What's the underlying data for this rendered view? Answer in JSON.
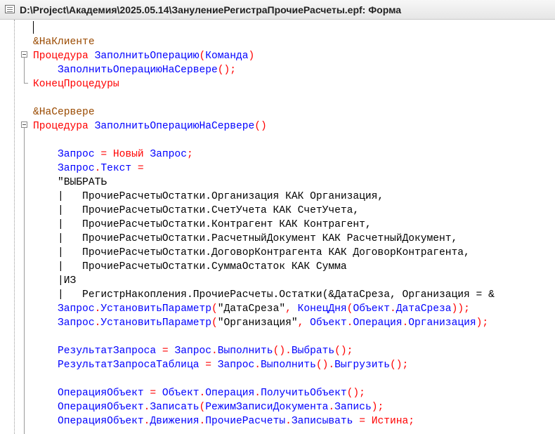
{
  "window": {
    "title": "D:\\Project\\Академия\\2025.05.14\\ЗанулениеРегистраПрочиеРасчеты.epf: Форма"
  },
  "code": {
    "lines": [
      [
        {
          "t": "&НаКлиенте",
          "c": "dir"
        }
      ],
      [
        {
          "t": "Процедура ",
          "c": "kw"
        },
        {
          "t": "ЗаполнитьОперацию",
          "c": "bl"
        },
        {
          "t": "(",
          "c": "kw"
        },
        {
          "t": "Команда",
          "c": "bl"
        },
        {
          "t": ")",
          "c": "kw"
        }
      ],
      [
        {
          "t": "    ",
          "c": "bl"
        },
        {
          "t": "ЗаполнитьОперациюНаСервере",
          "c": "bl"
        },
        {
          "t": "();",
          "c": "kw"
        }
      ],
      [
        {
          "t": "КонецПроцедуры",
          "c": "kw"
        }
      ],
      [],
      [
        {
          "t": "&НаСервере",
          "c": "dir"
        }
      ],
      [
        {
          "t": "Процедура ",
          "c": "kw"
        },
        {
          "t": "ЗаполнитьОперациюНаСервере",
          "c": "bl"
        },
        {
          "t": "()",
          "c": "kw"
        }
      ],
      [],
      [
        {
          "t": "    Запрос ",
          "c": "bl"
        },
        {
          "t": "= Новый ",
          "c": "kw"
        },
        {
          "t": "Запрос",
          "c": "bl"
        },
        {
          "t": ";",
          "c": "kw"
        }
      ],
      [
        {
          "t": "    Запрос",
          "c": "bl"
        },
        {
          "t": ".",
          "c": "kw"
        },
        {
          "t": "Текст ",
          "c": "bl"
        },
        {
          "t": "=",
          "c": "kw"
        }
      ],
      [
        {
          "t": "    \"ВЫБРАТЬ",
          "c": "bk"
        }
      ],
      [
        {
          "t": "    |   ПрочиеРасчетыОстатки.Организация КАК Организация,",
          "c": "bk"
        }
      ],
      [
        {
          "t": "    |   ПрочиеРасчетыОстатки.СчетУчета КАК СчетУчета,",
          "c": "bk"
        }
      ],
      [
        {
          "t": "    |   ПрочиеРасчетыОстатки.Контрагент КАК Контрагент,",
          "c": "bk"
        }
      ],
      [
        {
          "t": "    |   ПрочиеРасчетыОстатки.РасчетныйДокумент КАК РасчетныйДокумент,",
          "c": "bk"
        }
      ],
      [
        {
          "t": "    |   ПрочиеРасчетыОстатки.ДоговорКонтрагента КАК ДоговорКонтрагента,",
          "c": "bk"
        }
      ],
      [
        {
          "t": "    |   ПрочиеРасчетыОстатки.СуммаОстаток КАК Сумма",
          "c": "bk"
        }
      ],
      [
        {
          "t": "    |ИЗ",
          "c": "bk"
        }
      ],
      [
        {
          "t": "    |   РегистрНакопления.ПрочиеРасчеты.Остатки(&ДатаСреза, Организация = &",
          "c": "bk"
        }
      ],
      [
        {
          "t": "    Запрос",
          "c": "bl"
        },
        {
          "t": ".",
          "c": "kw"
        },
        {
          "t": "УстановитьПараметр",
          "c": "bl"
        },
        {
          "t": "(",
          "c": "kw"
        },
        {
          "t": "\"ДатаСреза\"",
          "c": "bk"
        },
        {
          "t": ", ",
          "c": "kw"
        },
        {
          "t": "КонецДня",
          "c": "bl"
        },
        {
          "t": "(",
          "c": "kw"
        },
        {
          "t": "Объект",
          "c": "bl"
        },
        {
          "t": ".",
          "c": "kw"
        },
        {
          "t": "ДатаСреза",
          "c": "bl"
        },
        {
          "t": "));",
          "c": "kw"
        }
      ],
      [
        {
          "t": "    Запрос",
          "c": "bl"
        },
        {
          "t": ".",
          "c": "kw"
        },
        {
          "t": "УстановитьПараметр",
          "c": "bl"
        },
        {
          "t": "(",
          "c": "kw"
        },
        {
          "t": "\"Организация\"",
          "c": "bk"
        },
        {
          "t": ", ",
          "c": "kw"
        },
        {
          "t": "Объект",
          "c": "bl"
        },
        {
          "t": ".",
          "c": "kw"
        },
        {
          "t": "Операция",
          "c": "bl"
        },
        {
          "t": ".",
          "c": "kw"
        },
        {
          "t": "Организация",
          "c": "bl"
        },
        {
          "t": ");",
          "c": "kw"
        }
      ],
      [],
      [
        {
          "t": "    РезультатЗапроса ",
          "c": "bl"
        },
        {
          "t": "= ",
          "c": "kw"
        },
        {
          "t": "Запрос",
          "c": "bl"
        },
        {
          "t": ".",
          "c": "kw"
        },
        {
          "t": "Выполнить",
          "c": "bl"
        },
        {
          "t": "().",
          "c": "kw"
        },
        {
          "t": "Выбрать",
          "c": "bl"
        },
        {
          "t": "();",
          "c": "kw"
        }
      ],
      [
        {
          "t": "    РезультатЗапросаТаблица ",
          "c": "bl"
        },
        {
          "t": "= ",
          "c": "kw"
        },
        {
          "t": "Запрос",
          "c": "bl"
        },
        {
          "t": ".",
          "c": "kw"
        },
        {
          "t": "Выполнить",
          "c": "bl"
        },
        {
          "t": "().",
          "c": "kw"
        },
        {
          "t": "Выгрузить",
          "c": "bl"
        },
        {
          "t": "();",
          "c": "kw"
        }
      ],
      [],
      [
        {
          "t": "    ОперацияОбъект ",
          "c": "bl"
        },
        {
          "t": "= ",
          "c": "kw"
        },
        {
          "t": "Объект",
          "c": "bl"
        },
        {
          "t": ".",
          "c": "kw"
        },
        {
          "t": "Операция",
          "c": "bl"
        },
        {
          "t": ".",
          "c": "kw"
        },
        {
          "t": "ПолучитьОбъект",
          "c": "bl"
        },
        {
          "t": "();",
          "c": "kw"
        }
      ],
      [
        {
          "t": "    ОперацияОбъект",
          "c": "bl"
        },
        {
          "t": ".",
          "c": "kw"
        },
        {
          "t": "Записать",
          "c": "bl"
        },
        {
          "t": "(",
          "c": "kw"
        },
        {
          "t": "РежимЗаписиДокумента",
          "c": "bl"
        },
        {
          "t": ".",
          "c": "kw"
        },
        {
          "t": "Запись",
          "c": "bl"
        },
        {
          "t": ");",
          "c": "kw"
        }
      ],
      [
        {
          "t": "    ОперацияОбъект",
          "c": "bl"
        },
        {
          "t": ".",
          "c": "kw"
        },
        {
          "t": "Движения",
          "c": "bl"
        },
        {
          "t": ".",
          "c": "kw"
        },
        {
          "t": "ПрочиеРасчеты",
          "c": "bl"
        },
        {
          "t": ".",
          "c": "kw"
        },
        {
          "t": "Записывать ",
          "c": "bl"
        },
        {
          "t": "= Истина;",
          "c": "kw"
        }
      ]
    ]
  }
}
